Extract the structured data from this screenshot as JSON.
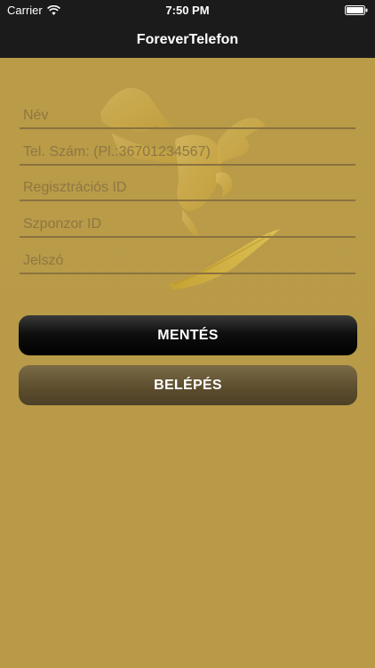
{
  "status_bar": {
    "carrier": "Carrier",
    "time": "7:50 PM",
    "wifi_icon": "wifi-icon",
    "battery_icon": "battery-icon"
  },
  "nav": {
    "title": "ForeverTelefon"
  },
  "colors": {
    "background": "#b89a49",
    "bar": "#1b1b1b",
    "save_button": "#000000",
    "login_button": "#5b4c2d"
  },
  "logo_icon": "eagle-logo",
  "form": {
    "name_placeholder": "Név",
    "phone_placeholder": "Tel. Szám: (Pl.:36701234567)",
    "registration_placeholder": "Regisztrációs ID",
    "sponsor_placeholder": "Szponzor ID",
    "password_placeholder": "Jelszó"
  },
  "buttons": {
    "save_label": "MENTÉS",
    "login_label": "BELÉPÉS"
  }
}
